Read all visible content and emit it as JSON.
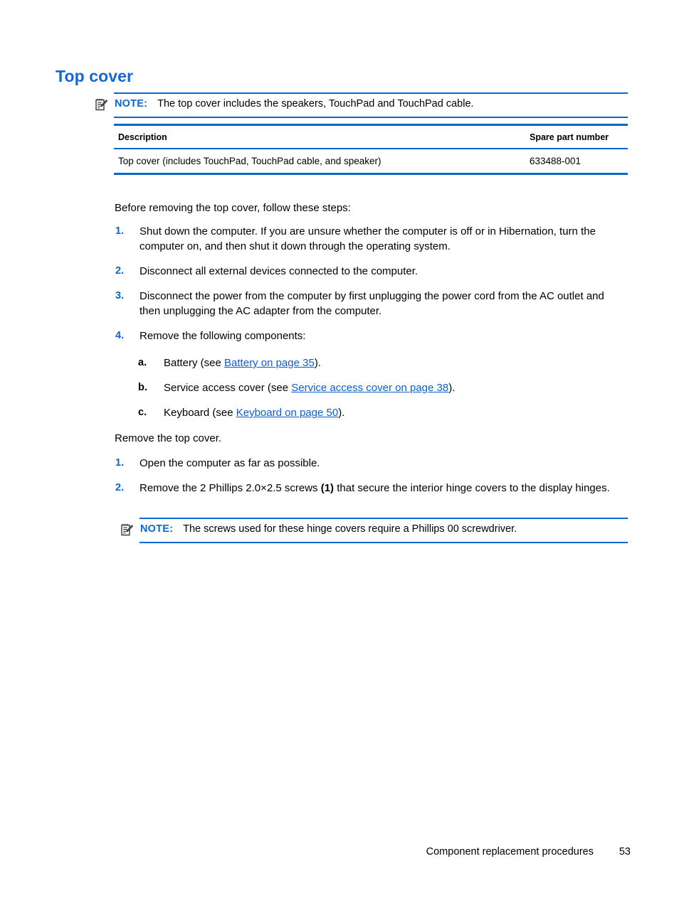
{
  "heading": "Top cover",
  "notes": {
    "top": {
      "icon": "note-pad-pencil-icon",
      "label": "NOTE:",
      "text": "The top cover includes the speakers, TouchPad and TouchPad cable."
    },
    "screws": {
      "icon": "note-pad-pencil-icon",
      "label": "NOTE:",
      "text": "The screws used for these hinge covers require a Phillips 00 screwdriver."
    }
  },
  "table": {
    "headers": {
      "description": "Description",
      "spare_part_number": "Spare part number"
    },
    "rows": [
      {
        "description": "Top cover (includes TouchPad, TouchPad cable, and speaker)",
        "spare_part_number": "633488-001"
      }
    ]
  },
  "intro_paragraph": "Before removing the top cover, follow these steps:",
  "pre_steps": [
    {
      "marker": "1.",
      "text": "Shut down the computer. If you are unsure whether the computer is off or in Hibernation, turn the computer on, and then shut it down through the operating system."
    },
    {
      "marker": "2.",
      "text": "Disconnect all external devices connected to the computer."
    },
    {
      "marker": "3.",
      "text": "Disconnect the power from the computer by first unplugging the power cord from the AC outlet and then unplugging the AC adapter from the computer."
    },
    {
      "marker": "4.",
      "text": "Remove the following components:"
    }
  ],
  "components": [
    {
      "marker": "a.",
      "prefix": "Battery (see ",
      "link": "Battery on page 35",
      "suffix": ")."
    },
    {
      "marker": "b.",
      "prefix": "Service access cover (see ",
      "link": "Service access cover on page 38",
      "suffix": ")."
    },
    {
      "marker": "c.",
      "prefix": "Keyboard (see ",
      "link": "Keyboard on page 50",
      "suffix": ")."
    }
  ],
  "remove_paragraph": "Remove the top cover.",
  "remove_steps": [
    {
      "marker": "1.",
      "text": "Open the computer as far as possible."
    },
    {
      "marker": "2.",
      "prefix": "Remove the 2 Phillips 2.0×2.5 screws ",
      "callout": "(1)",
      "suffix": " that secure the interior hinge covers to the display hinges."
    }
  ],
  "footer": {
    "title": "Component replacement procedures",
    "page_number": "53"
  },
  "colors": {
    "accent_blue": "#0a66d0",
    "heading_blue": "#1567d3",
    "link_blue": "#0a5fd4"
  }
}
